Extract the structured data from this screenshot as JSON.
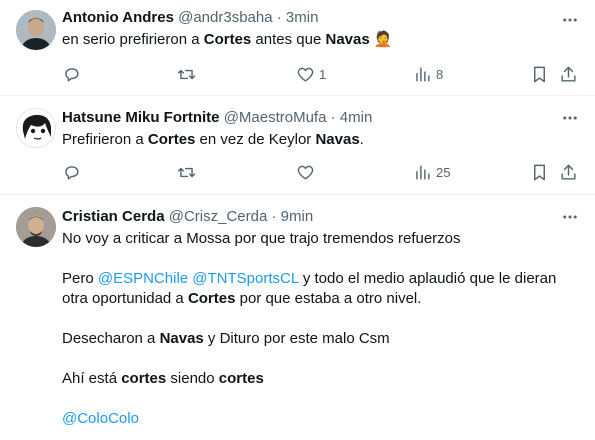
{
  "tweets": [
    {
      "name": "Antonio Andres",
      "handle": "@andr3sbaha",
      "time": "3min",
      "text": [
        {
          "t": "en serio prefirieron a ",
          "b": false
        },
        {
          "t": "Cortes",
          "b": true
        },
        {
          "t": " antes que ",
          "b": false
        },
        {
          "t": "Navas",
          "b": true
        },
        {
          "t": " ",
          "b": false
        }
      ],
      "emoji": "🤦",
      "likes": "1",
      "views": "8"
    },
    {
      "name": "Hatsune Miku Fortnite",
      "handle": "@MaestroMufa",
      "time": "4min",
      "text": [
        {
          "t": "Prefirieron a ",
          "b": false
        },
        {
          "t": "Cortes",
          "b": true
        },
        {
          "t": " en vez de Keylor ",
          "b": false
        },
        {
          "t": "Navas",
          "b": true
        },
        {
          "t": ".",
          "b": false
        }
      ],
      "views": "25"
    },
    {
      "name": "Cristian Cerda",
      "handle": "@Crisz_Cerda",
      "time": "9min",
      "p1": "No voy a criticar a Mossa por que trajo tremendos refuerzos",
      "p2_mention1": "@ESPNChile",
      "p2_mention2": "@TNTSportsCL",
      "p2_pre": "Pero ",
      "p2_mid": " todo el medio aplaudió que le dieran otra oportunidad a ",
      "p2_and": " y",
      "p2_bold": "Cortes",
      "p2_end": " por que estaba a otro nivel.",
      "p3_pre": "Desecharon a ",
      "p3_bold": "Navas",
      "p3_end": " y Dituro por este malo Csm",
      "p4_pre": "Ahí está ",
      "p4_bold1": "cortes",
      "p4_mid": " siendo ",
      "p4_bold2": "cortes",
      "p5_mention": "@ColoColo"
    }
  ],
  "separator": "·",
  "icons": [
    "reply-icon",
    "retweet-icon",
    "like-icon",
    "views-icon",
    "bookmark-icon",
    "share-icon",
    "more-icon"
  ],
  "colors": {
    "link": "#1d9bf0",
    "muted": "#536471",
    "text": "#0f1419",
    "divider": "#eff3f4"
  }
}
